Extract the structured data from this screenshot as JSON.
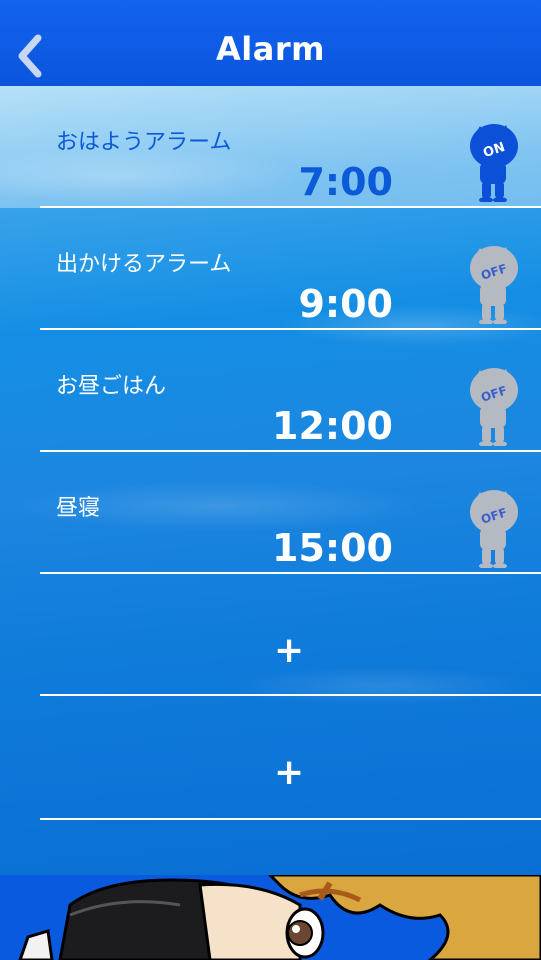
{
  "header": {
    "title": "Alarm",
    "back_icon": "chevron-left-icon"
  },
  "alarms": [
    {
      "name": "おはようアラーム",
      "time": "7:00",
      "state": "ON"
    },
    {
      "name": "出かけるアラーム",
      "time": "9:00",
      "state": "OFF"
    },
    {
      "name": "お昼ごはん",
      "time": "12:00",
      "state": "OFF"
    },
    {
      "name": "昼寝",
      "time": "15:00",
      "state": "OFF"
    }
  ],
  "add_slots": [
    {
      "label": "+"
    },
    {
      "label": "+"
    }
  ],
  "colors": {
    "accent": "#0b55dd",
    "on_text": "#0c5ad8",
    "off_toggle": "#b5b9c2"
  }
}
